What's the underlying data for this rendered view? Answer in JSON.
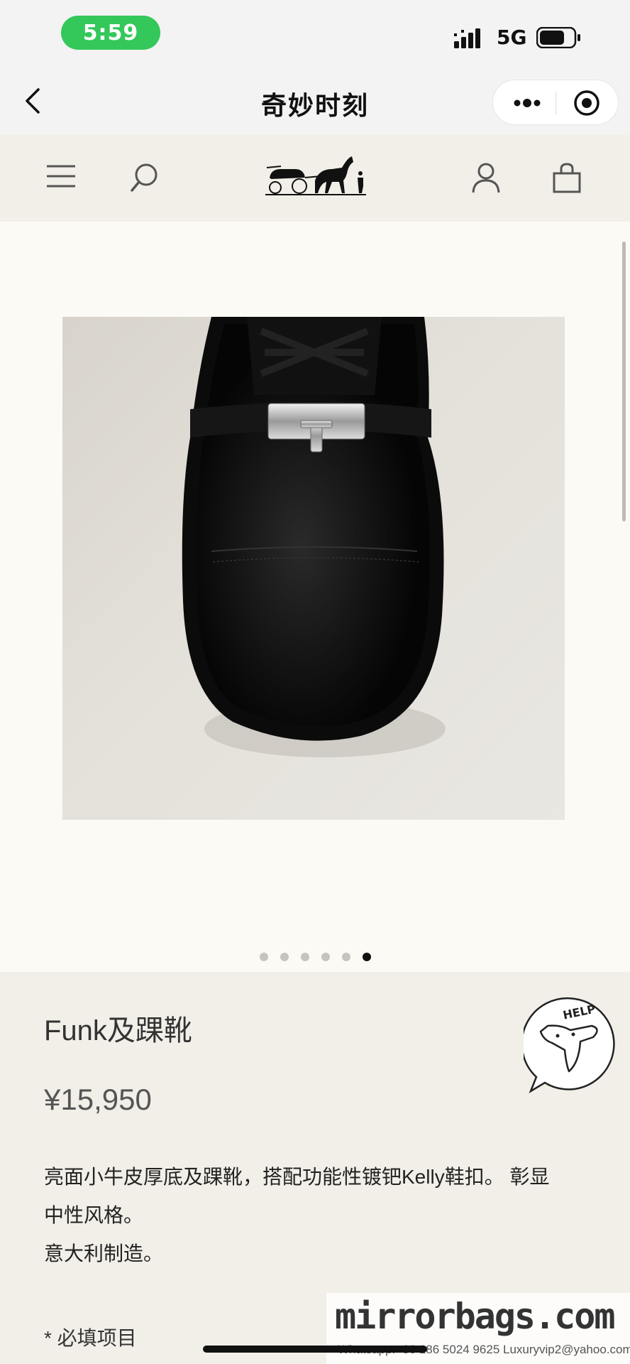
{
  "status_bar": {
    "time": "5:59",
    "network": "5G",
    "icons": [
      "signal-icon",
      "battery-icon"
    ]
  },
  "miniapp_nav": {
    "title": "奇妙时刻",
    "icons": [
      "back-icon",
      "more-icon",
      "close-icon"
    ]
  },
  "site_header": {
    "icons": [
      "menu-icon",
      "search-icon",
      "carriage-logo",
      "account-icon",
      "bag-icon"
    ]
  },
  "gallery": {
    "image_alt": "black leather ankle boot with silver Kelly buckle",
    "slide_count": 6,
    "active_slide": 6
  },
  "product": {
    "name": "Funk及踝靴",
    "price": "¥15,950",
    "description_lines": [
      "亮面小牛皮厚底及踝靴，搭配功能性镀钯Kelly鞋扣。 彰显",
      "中性风格。",
      "意大利制造。"
    ],
    "required_note": "* 必填项目"
  },
  "help_badge": {
    "label": "HELP"
  },
  "watermark": {
    "brand": "mirrorbags.com",
    "contact": "Whatsapp:+86 186 5024 9625  Luxuryvip2@yahoo.com"
  },
  "colors": {
    "status_green": "#34c759",
    "page_bg": "#f2efe8",
    "gallery_bg": "#fcfaf5",
    "active_dot": "#111111"
  }
}
